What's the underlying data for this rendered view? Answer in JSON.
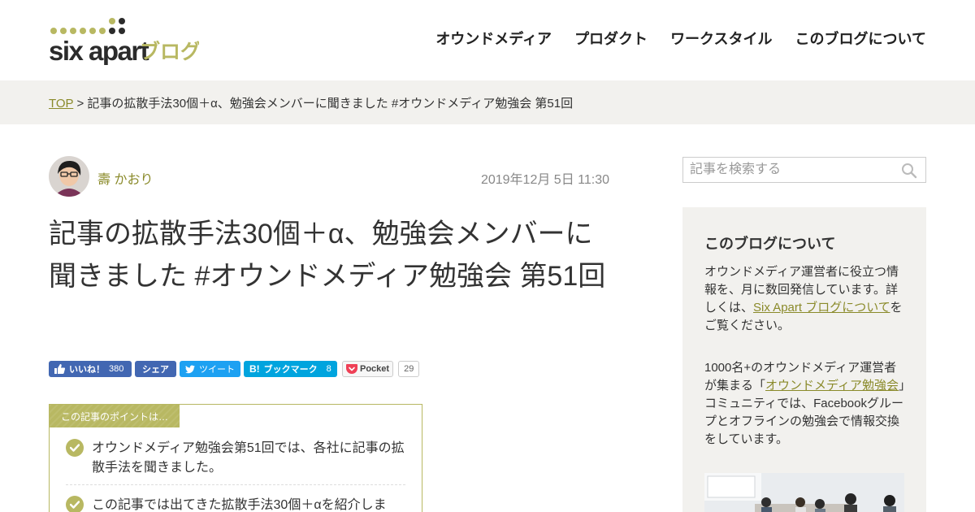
{
  "logo": {
    "brand": "six apart",
    "suffix": "ブログ"
  },
  "nav": {
    "items": [
      "オウンドメディア",
      "プロダクト",
      "ワークスタイル",
      "このブログについて"
    ]
  },
  "breadcrumb": {
    "top": "TOP",
    "separator": ">",
    "current": "記事の拡散手法30個＋α、勉強会メンバーに聞きました #オウンドメディア勉強会 第51回"
  },
  "article": {
    "author": "壽 かおり",
    "date": "2019年12月 5日 11:30",
    "title": "記事の拡散手法30個＋α、勉強会メンバーに聞きました #オウンドメディア勉強会 第51回"
  },
  "share": {
    "facebook_like": "いいね！",
    "facebook_like_count": "380",
    "facebook_share": "シェア",
    "tweet": "ツイート",
    "hatena_logo": "B!",
    "hatena": "ブックマーク",
    "hatena_count": "8",
    "pocket": "Pocket",
    "pocket_count": "29"
  },
  "points": {
    "label": "この記事のポイントは…",
    "items": [
      "オウンドメディア勉強会第51回では、各社に記事の拡散手法を聞きました。",
      "この記事では出てきた拡散手法30個＋αを紹介しま"
    ]
  },
  "sidebar": {
    "search_placeholder": "記事を検索する",
    "about_title": "このブログについて",
    "about_p1_before": "オウンドメディア運営者に役立つ情報を、月に数回発信しています。詳しくは、",
    "about_p1_link": "Six Apart ブログについて",
    "about_p1_after": "をご覧ください。",
    "about_p2_before": "1000名+のオウンドメディア運営者が集まる「",
    "about_p2_link": "オウンドメディア勉強会",
    "about_p2_after": "」コミュニティでは、Facebookグループとオフラインの勉強会で情報交換をしています。"
  },
  "colors": {
    "accent": "#b8b862",
    "link": "#8a8a2a",
    "logo_dark": "#2b2b2b",
    "breadcrumb_bg": "#f2f1ee",
    "facebook": "#4267b2",
    "twitter": "#1da1f2",
    "hatena": "#00a4de",
    "pocket": "#ef4056"
  }
}
